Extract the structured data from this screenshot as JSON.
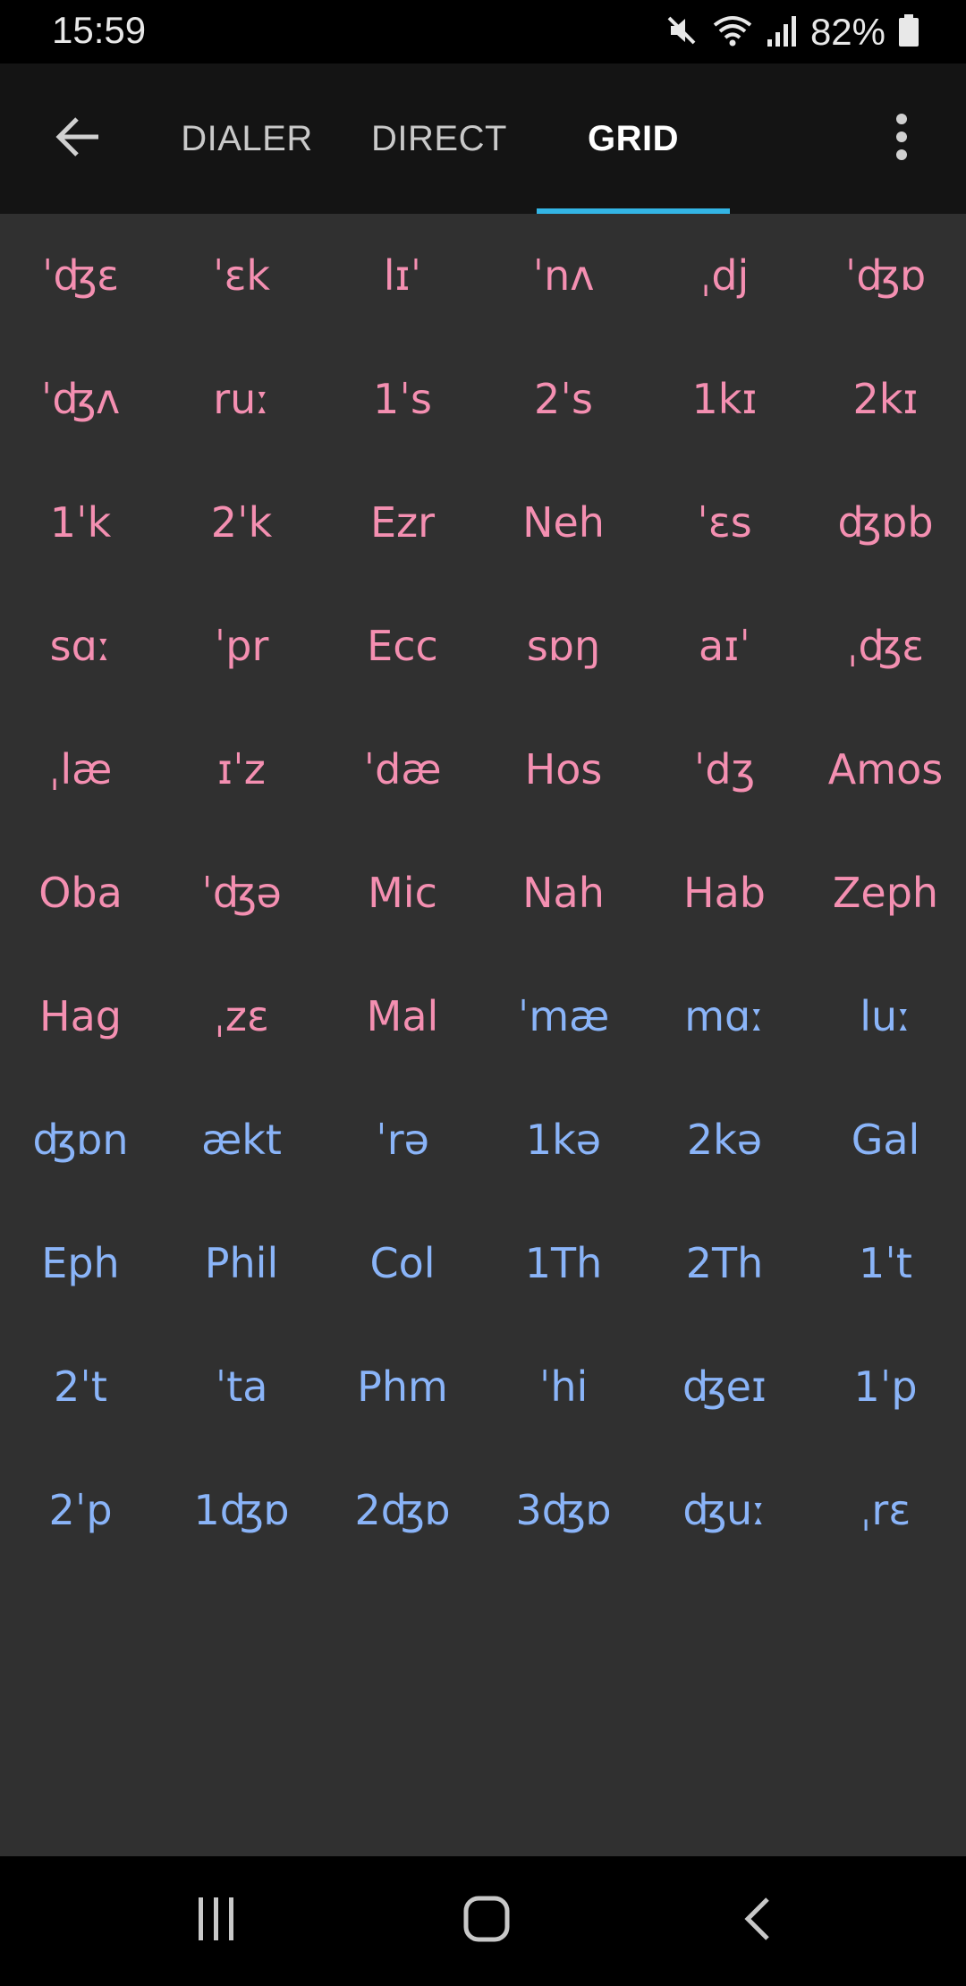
{
  "status_bar": {
    "time": "15:59",
    "battery": "82%",
    "icons": [
      "mute-icon",
      "wifi-icon",
      "signal-icon",
      "battery-icon"
    ]
  },
  "app_bar": {
    "back_icon": "arrow-left-icon",
    "tabs": [
      {
        "label": "DIALER",
        "active": false
      },
      {
        "label": "DIRECT",
        "active": false
      },
      {
        "label": "GRID",
        "active": true
      }
    ],
    "overflow_icon": "more-vert-icon",
    "indicator_color": "#33b5e5"
  },
  "colors": {
    "old_testament": "#f48fb1",
    "new_testament": "#8ab4f8"
  },
  "grid": {
    "rows": [
      [
        {
          "t": "ˈʤɛ",
          "g": "ot"
        },
        {
          "t": "ˈɛk",
          "g": "ot"
        },
        {
          "t": "lɪˈ",
          "g": "ot"
        },
        {
          "t": "ˈnʌ",
          "g": "ot"
        },
        {
          "t": "ˌdj",
          "g": "ot"
        },
        {
          "t": "ˈʤɒ",
          "g": "ot"
        }
      ],
      [
        {
          "t": "ˈʤʌ",
          "g": "ot"
        },
        {
          "t": "ruː",
          "g": "ot"
        },
        {
          "t": "1ˈs",
          "g": "ot"
        },
        {
          "t": "2ˈs",
          "g": "ot"
        },
        {
          "t": "1kɪ",
          "g": "ot"
        },
        {
          "t": "2kɪ",
          "g": "ot"
        }
      ],
      [
        {
          "t": "1ˈk",
          "g": "ot"
        },
        {
          "t": "2ˈk",
          "g": "ot"
        },
        {
          "t": "Ezr",
          "g": "ot"
        },
        {
          "t": "Neh",
          "g": "ot"
        },
        {
          "t": "ˈɛs",
          "g": "ot"
        },
        {
          "t": "ʤɒb",
          "g": "ot"
        }
      ],
      [
        {
          "t": "sɑː",
          "g": "ot"
        },
        {
          "t": "ˈpr",
          "g": "ot"
        },
        {
          "t": "Ecc",
          "g": "ot"
        },
        {
          "t": "sɒŋ",
          "g": "ot"
        },
        {
          "t": "aɪˈ",
          "g": "ot"
        },
        {
          "t": "ˌʤɛ",
          "g": "ot"
        }
      ],
      [
        {
          "t": "ˌlæ",
          "g": "ot"
        },
        {
          "t": "ɪˈz",
          "g": "ot"
        },
        {
          "t": "ˈdæ",
          "g": "ot"
        },
        {
          "t": "Hos",
          "g": "ot"
        },
        {
          "t": "ˈdʒ",
          "g": "ot"
        },
        {
          "t": "Amos",
          "g": "ot"
        }
      ],
      [
        {
          "t": "Oba",
          "g": "ot"
        },
        {
          "t": "ˈʤə",
          "g": "ot"
        },
        {
          "t": "Mic",
          "g": "ot"
        },
        {
          "t": "Nah",
          "g": "ot"
        },
        {
          "t": "Hab",
          "g": "ot"
        },
        {
          "t": "Zeph",
          "g": "ot"
        }
      ],
      [
        {
          "t": "Hag",
          "g": "ot"
        },
        {
          "t": "ˌzɛ",
          "g": "ot"
        },
        {
          "t": "Mal",
          "g": "ot"
        },
        {
          "t": "ˈmæ",
          "g": "nt"
        },
        {
          "t": "mɑː",
          "g": "nt"
        },
        {
          "t": "luː",
          "g": "nt"
        }
      ],
      [
        {
          "t": "ʤɒn",
          "g": "nt"
        },
        {
          "t": "ækt",
          "g": "nt"
        },
        {
          "t": "ˈrə",
          "g": "nt"
        },
        {
          "t": "1kə",
          "g": "nt"
        },
        {
          "t": "2kə",
          "g": "nt"
        },
        {
          "t": "Gal",
          "g": "nt"
        }
      ],
      [
        {
          "t": "Eph",
          "g": "nt"
        },
        {
          "t": "Phil",
          "g": "nt"
        },
        {
          "t": "Col",
          "g": "nt"
        },
        {
          "t": "1Th",
          "g": "nt"
        },
        {
          "t": "2Th",
          "g": "nt"
        },
        {
          "t": "1ˈt",
          "g": "nt"
        }
      ],
      [
        {
          "t": "2ˈt",
          "g": "nt"
        },
        {
          "t": "ˈta",
          "g": "nt"
        },
        {
          "t": "Phm",
          "g": "nt"
        },
        {
          "t": "ˈhi",
          "g": "nt"
        },
        {
          "t": "ʤeɪ",
          "g": "nt"
        },
        {
          "t": "1ˈp",
          "g": "nt"
        }
      ],
      [
        {
          "t": "2ˈp",
          "g": "nt"
        },
        {
          "t": "1ʤɒ",
          "g": "nt"
        },
        {
          "t": "2ʤɒ",
          "g": "nt"
        },
        {
          "t": "3ʤɒ",
          "g": "nt"
        },
        {
          "t": "ʤuː",
          "g": "nt"
        },
        {
          "t": "ˌrɛ",
          "g": "nt"
        }
      ]
    ]
  },
  "nav_bar": {
    "buttons": [
      "recents-icon",
      "home-icon",
      "back-icon"
    ]
  }
}
